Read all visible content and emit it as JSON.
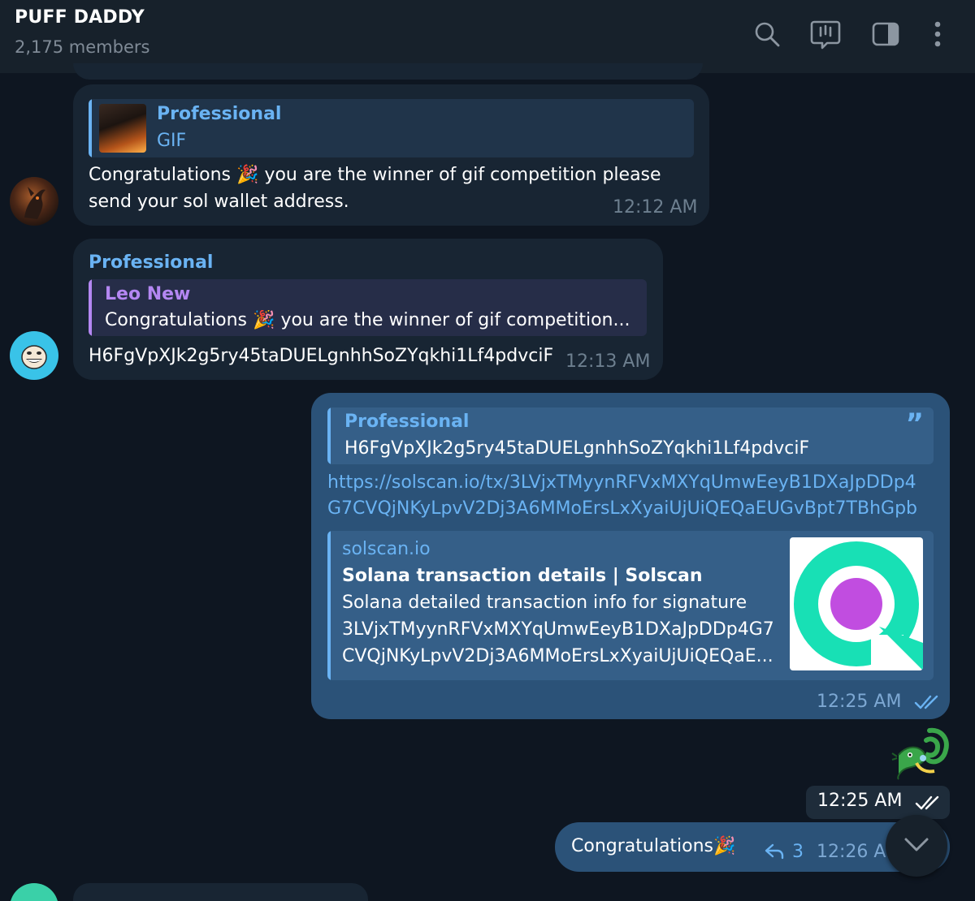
{
  "header": {
    "title": "PUFF DADDY",
    "subtitle": "2,175 members",
    "icons": [
      "search-icon",
      "voice-chat-icon",
      "sidebar-toggle-icon",
      "more-vert-icon"
    ]
  },
  "messages": {
    "m1": {
      "reply_name": "Professional",
      "reply_text": "GIF",
      "text_line1": "Congratulations",
      "text_line1b": "you are the winner of gif competition please",
      "text_line2": "send your sol wallet address.",
      "emoji": "🎉",
      "time": "12:12 AM"
    },
    "m2": {
      "sender": "Professional",
      "reply_name": "Leo New",
      "reply_text_a": "Congratulations",
      "reply_text_b": "you are the winner of gif competition...",
      "emoji": "🎉",
      "text": "H6FgVpXJk2g5ry45taDUELgnhhSoZYqkhi1Lf4pdvciF",
      "time": "12:13 AM"
    },
    "m3": {
      "quote_name": "Professional",
      "quote_text": "H6FgVpXJk2g5ry45taDUELgnhhSoZYqkhi1Lf4pdvciF",
      "quote_mark": "”",
      "link_line1": "https://solscan.io/tx/3LVjxTMyynRFVxMXYqUmwEeyB1DXaJpDDp4",
      "link_line2": "G7CVQjNKyLpvV2Dj3A6MMoErsLxXyaiUjUiQEQaEUGvBpt7TBhGpb",
      "preview_site": "solscan.io",
      "preview_title": "Solana transaction details | Solscan",
      "preview_line1": "Solana detailed transaction info for signature",
      "preview_line2": "3LVjxTMyynRFVxMXYqUmwEeyB1DXaJpDDp4G7",
      "preview_line3": "CVQjNKyLpvV2Dj3A6MMoErsLxXyaiUjUiQEQaE...",
      "time": "12:25 AM"
    },
    "m4": {
      "time": "12:25 AM"
    },
    "m5": {
      "text": "Congratulations",
      "emoji": "🎉",
      "reply_count": "3",
      "time": "12:26 AM"
    }
  },
  "colors": {
    "background": "#0e1621",
    "header": "#17212b",
    "incoming_bubble": "#182533",
    "outgoing_bubble": "#2b5278",
    "accent_blue": "#6ab3f3",
    "accent_purple": "#b487f2"
  }
}
